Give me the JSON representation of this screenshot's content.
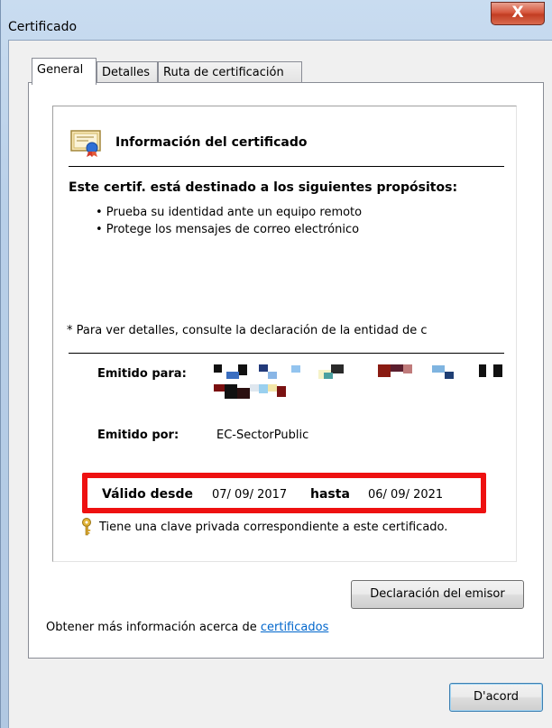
{
  "window": {
    "title": "Certificado",
    "close_label": "X"
  },
  "tabs": [
    {
      "label": "General",
      "active": true
    },
    {
      "label": "Detalles",
      "active": false
    },
    {
      "label": "Ruta de certificación",
      "active": false
    }
  ],
  "info": {
    "heading": "Información del certificado",
    "purposes_heading": "Este certif. está destinado a los siguientes propósitos:",
    "purposes": [
      "• Prueba su identidad ante un equipo remoto",
      "• Protege los mensajes de correo electrónico"
    ],
    "note": "* Para ver detalles, consulte la declaración de la entidad de c",
    "issued_to_label": "Emitido para:",
    "issued_by_label": "Emitido por:",
    "issued_by_value": "EC-SectorPublic",
    "valid_from_label": "Válido desde",
    "valid_from_value": "07/ 09/ 2017",
    "valid_to_label": "hasta",
    "valid_to_value": "06/ 09/ 2021",
    "private_key_note": "Tiene una clave privada correspondiente a este certificado."
  },
  "buttons": {
    "issuer_statement": "Declaración del emisor",
    "ok": "D'acord"
  },
  "footer": {
    "more_info_text": "Obtener más información acerca de",
    "more_info_link": "certificados"
  },
  "icons": {
    "certificate": "certificate-icon",
    "key": "key-icon",
    "close": "close-icon"
  },
  "colors": {
    "highlight_border": "#ee1111",
    "link": "#0066cc"
  }
}
